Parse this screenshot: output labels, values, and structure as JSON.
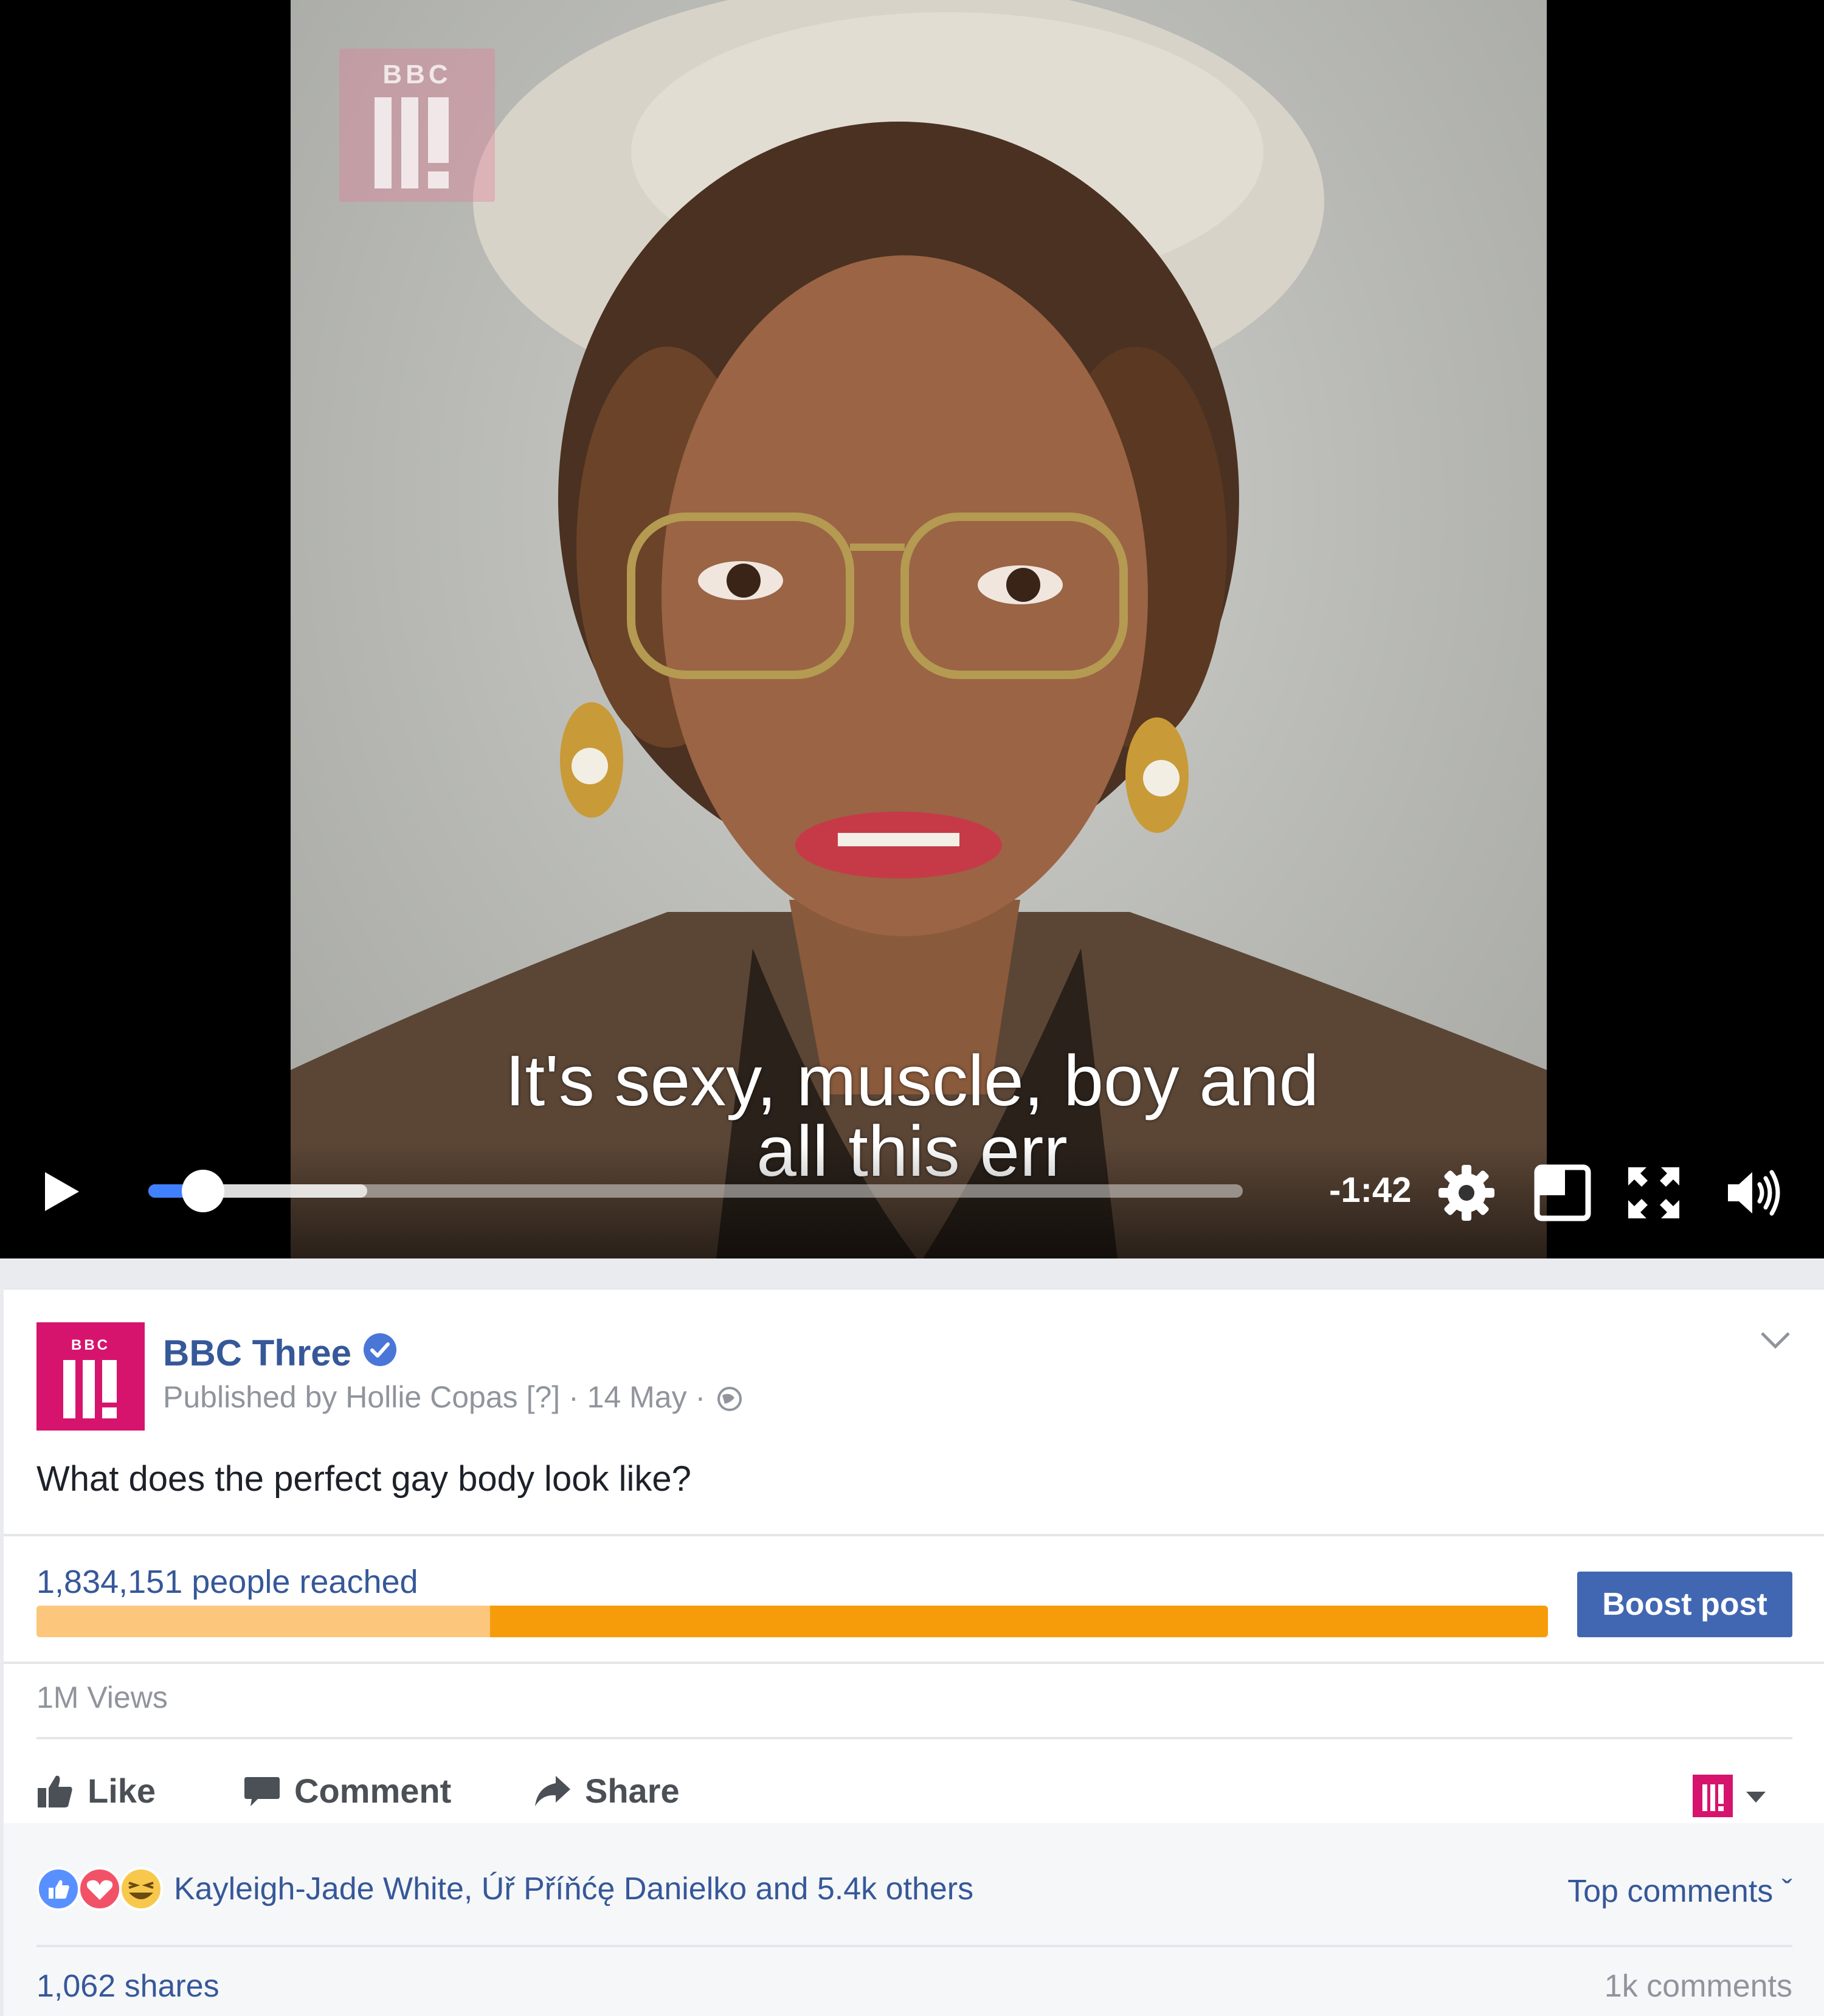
{
  "video": {
    "subtitle_line1": "It's sexy, muscle, boy and",
    "subtitle_line2": "all this err",
    "time_remaining": "-1:42",
    "progress_played": 0.05,
    "progress_buffered": 0.2,
    "watermark_text": "BBC",
    "controls": [
      "play-icon",
      "gear-icon",
      "pip-icon",
      "fullscreen-icon",
      "volume-icon"
    ]
  },
  "post": {
    "page_name": "BBC Three",
    "avatar_text": "BBC",
    "published_by": "Published by Hollie Copas",
    "help_marker": "[?]",
    "date": "14 May",
    "separator": "·",
    "text": "What does the perfect gay body look like?",
    "reach_text": "1,834,151 people reached",
    "reach_organic_fraction": 0.3,
    "boost_label": "Boost post",
    "views": "1M Views",
    "actions": {
      "like": "Like",
      "comment": "Comment",
      "share": "Share"
    },
    "reactions_text": "Kayleigh-Jade White, Úř Příňćę Danielko and 5.4k others",
    "top_comments": "Top comments ˇ",
    "shares": "1,062 shares",
    "comments": "1k comments"
  },
  "colors": {
    "link_blue": "#365899",
    "boost_blue": "#4267b2",
    "bbc_pink": "#d6146e",
    "reach_paid": "#f69c0b",
    "reach_organic": "#fcc77c",
    "progress_blue": "#4080ff"
  }
}
